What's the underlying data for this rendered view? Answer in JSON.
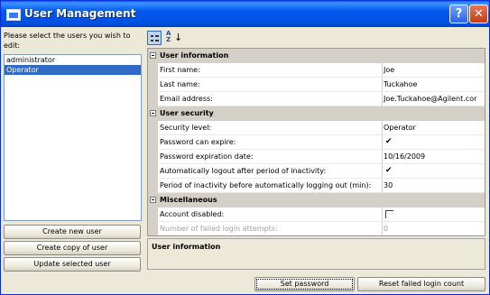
{
  "window": {
    "title": "User Management"
  },
  "prompt": "Please select the users you wish to edit:",
  "users": [
    {
      "name": "administrator",
      "selected": false
    },
    {
      "name": "Operator",
      "selected": true
    }
  ],
  "left_buttons": {
    "create_new": "Create new user",
    "create_copy": "Create copy of user",
    "update": "Update selected user"
  },
  "toolbar": {
    "categorized_icon": "categorized-icon",
    "sort_icon": "alphabetical-sort-icon"
  },
  "categories": [
    {
      "title": "User information",
      "rows": [
        {
          "label": "First name:",
          "value": "Joe"
        },
        {
          "label": "Last name:",
          "value": "Tuckahoe"
        },
        {
          "label": "Email address:",
          "value": "Joe.Tuckahoe@Agilent.cor"
        }
      ]
    },
    {
      "title": "User security",
      "rows": [
        {
          "label": "Security level:",
          "value": "Operator"
        },
        {
          "label": "Password can expire:",
          "value": "",
          "checkbox": true,
          "checked": true
        },
        {
          "label": "Password expiration date:",
          "value": "10/16/2009"
        },
        {
          "label": "Automatically logout after period of inactivity:",
          "value": "",
          "checkbox": true,
          "checked": true
        },
        {
          "label": "Period of inactivity before automatically logging out (min):",
          "value": "30"
        }
      ]
    },
    {
      "title": "Miscellaneous",
      "rows": [
        {
          "label": "Account disabled:",
          "value": "",
          "checkbox": true,
          "checked": false
        },
        {
          "label": "Number of failed login attempts:",
          "value": "0",
          "disabled": true
        }
      ]
    }
  ],
  "description_title": "User information",
  "bottom_buttons": {
    "set_password": "Set password",
    "reset_failed": "Reset failed login count"
  },
  "colors": {
    "title_bar": "#0058ee",
    "selection": "#316ac5",
    "close_button": "#c33b15"
  }
}
